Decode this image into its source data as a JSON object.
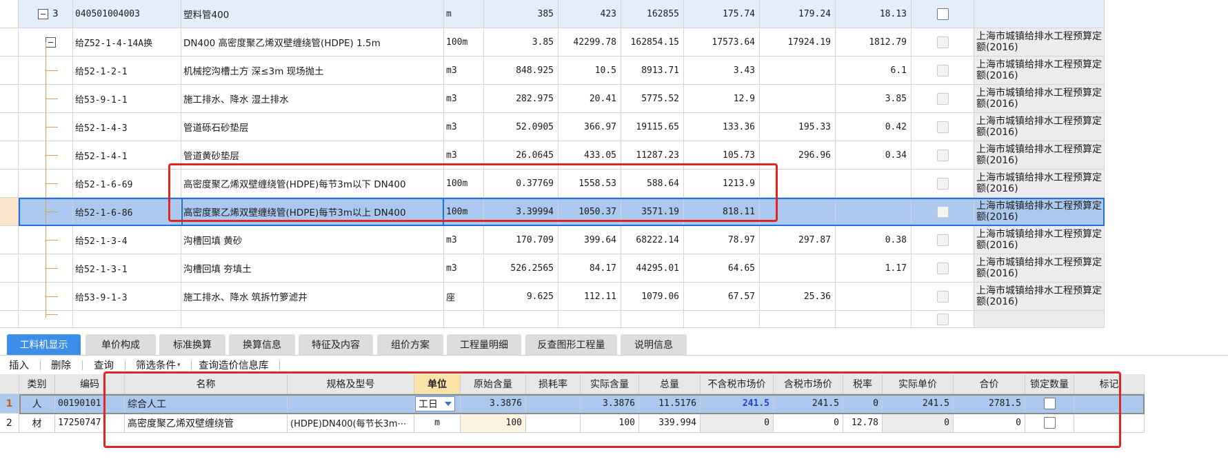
{
  "top_rows": [
    {
      "seq": "3",
      "code": "040501004003",
      "name": "塑料管400",
      "unit": "m",
      "qty": "385",
      "price": "423",
      "total": "162855",
      "labor": "175.74",
      "material": "179.24",
      "machine": "18.13",
      "source": ""
    },
    {
      "seq": "",
      "code": "给Z52-1-4-14A换",
      "name": "DN400 高密度聚乙烯双壁缠绕管(HDPE) 1.5m",
      "unit": "100m",
      "qty": "3.85",
      "price": "42299.78",
      "total": "162854.15",
      "labor": "17573.64",
      "material": "17924.19",
      "machine": "1812.79",
      "source": "上海市城镇给排水工程预算定额(2016)"
    },
    {
      "seq": "",
      "code": "给52-1-2-1",
      "name": "机械挖沟槽土方 深≤3m 现场抛土",
      "unit": "m3",
      "qty": "848.925",
      "price": "10.5",
      "total": "8913.71",
      "labor": "3.43",
      "material": "",
      "machine": "6.1",
      "source": "上海市城镇给排水工程预算定额(2016)"
    },
    {
      "seq": "",
      "code": "给53-9-1-1",
      "name": "施工排水、降水 湿土排水",
      "unit": "m3",
      "qty": "282.975",
      "price": "20.41",
      "total": "5775.52",
      "labor": "12.9",
      "material": "",
      "machine": "3.85",
      "source": "上海市城镇给排水工程预算定额(2016)"
    },
    {
      "seq": "",
      "code": "给52-1-4-3",
      "name": "管道砾石砂垫层",
      "unit": "m3",
      "qty": "52.0905",
      "price": "366.97",
      "total": "19115.65",
      "labor": "133.36",
      "material": "195.33",
      "machine": "0.42",
      "source": "上海市城镇给排水工程预算定额(2016)"
    },
    {
      "seq": "",
      "code": "给52-1-4-1",
      "name": "管道黄砂垫层",
      "unit": "m3",
      "qty": "26.0645",
      "price": "433.05",
      "total": "11287.23",
      "labor": "105.73",
      "material": "296.96",
      "machine": "0.34",
      "source": "上海市城镇给排水工程预算定额(2016)"
    },
    {
      "seq": "",
      "code": "给52-1-6-69",
      "name": "高密度聚乙烯双壁缠绕管(HDPE)每节3m以下 DN400",
      "unit": "100m",
      "qty": "0.37769",
      "price": "1558.53",
      "total": "588.64",
      "labor": "1213.9",
      "material": "",
      "machine": "",
      "source": "上海市城镇给排水工程预算定额(2016)"
    },
    {
      "seq": "",
      "code": "给52-1-6-86",
      "name": "高密度聚乙烯双壁缠绕管(HDPE)每节3m以上 DN400",
      "unit": "100m",
      "qty": "3.39994",
      "price": "1050.37",
      "total": "3571.19",
      "labor": "818.11",
      "material": "",
      "machine": "",
      "source": "上海市城镇给排水工程预算定额(2016)"
    },
    {
      "seq": "",
      "code": "给52-1-3-4",
      "name": "沟槽回填 黄砂",
      "unit": "m3",
      "qty": "170.709",
      "price": "399.64",
      "total": "68222.14",
      "labor": "78.97",
      "material": "297.87",
      "machine": "0.38",
      "source": "上海市城镇给排水工程预算定额(2016)"
    },
    {
      "seq": "",
      "code": "给52-1-3-1",
      "name": "沟槽回填 夯填土",
      "unit": "m3",
      "qty": "526.2565",
      "price": "84.17",
      "total": "44295.01",
      "labor": "64.65",
      "material": "",
      "machine": "1.17",
      "source": "上海市城镇给排水工程预算定额(2016)"
    },
    {
      "seq": "",
      "code": "给53-9-1-3",
      "name": "施工排水、降水 筑拆竹箩滤井",
      "unit": "座",
      "qty": "9.625",
      "price": "112.11",
      "total": "1079.06",
      "labor": "67.57",
      "material": "25.36",
      "machine": "",
      "source": "上海市城镇给排水工程预算定额(2016)"
    }
  ],
  "tabs": [
    "工料机显示",
    "单价构成",
    "标准换算",
    "换算信息",
    "特征及内容",
    "组价方案",
    "工程量明细",
    "反查图形工程量",
    "说明信息"
  ],
  "toolbar": [
    "插入",
    "删除",
    "查询",
    "筛选条件",
    "查询造价信息库"
  ],
  "bottom_headers": [
    "类别",
    "编码",
    "名称",
    "规格及型号",
    "单位",
    "原始含量",
    "损耗率",
    "实际含量",
    "总量",
    "不含税市场价",
    "含税市场价",
    "税率",
    "实际单价",
    "合价",
    "锁定数量",
    "标记"
  ],
  "bottom_rows": [
    {
      "idx": "1",
      "type": "人",
      "code": "00190101",
      "name": "综合人工",
      "spec": "",
      "unit": "工日",
      "orig": "3.3876",
      "loss": "",
      "actual": "3.3876",
      "total": "11.5176",
      "market_ex": "241.5",
      "market_in": "241.5",
      "tax": "0",
      "unit_price": "241.5",
      "amount": "2781.5"
    },
    {
      "idx": "2",
      "type": "材",
      "code": "17250747",
      "name": "高密度聚乙烯双壁缠绕管",
      "spec": "(HDPE)DN400(每节长3m⋯",
      "unit": "m",
      "orig": "100",
      "loss": "",
      "actual": "100",
      "total": "339.994",
      "market_ex": "0",
      "market_in": "0",
      "tax": "12.78",
      "unit_price": "0",
      "amount": "0"
    }
  ],
  "colors": {
    "selected_row": "#abc9ef",
    "header_row": "#e4eefa",
    "active_tab": "#3d8eea",
    "highlight": "#e62323",
    "selection_border": "#1e6fe0"
  }
}
